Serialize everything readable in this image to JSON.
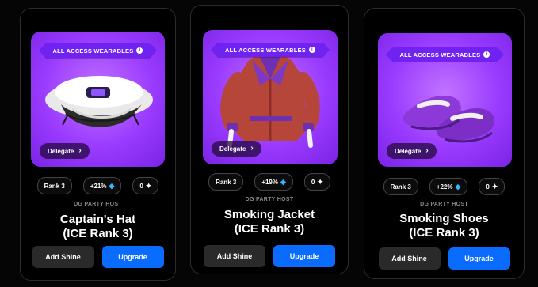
{
  "cards": [
    {
      "badge": "ALL ACCESS WEARABLES",
      "delegate": "Delegate",
      "rank": "Rank 3",
      "bonus": "+21%",
      "count": "0",
      "host": "DG PARTY HOST",
      "title_line1": "Captain's Hat",
      "title_line2": "(ICE Rank 3)",
      "add_shine": "Add Shine",
      "upgrade": "Upgrade"
    },
    {
      "badge": "ALL ACCESS WEARABLES",
      "delegate": "Delegate",
      "rank": "Rank 3",
      "bonus": "+19%",
      "count": "0",
      "host": "DG PARTY HOST",
      "title_line1": "Smoking Jacket",
      "title_line2": "(ICE Rank 3)",
      "add_shine": "Add Shine",
      "upgrade": "Upgrade"
    },
    {
      "badge": "ALL ACCESS WEARABLES",
      "delegate": "Delegate",
      "rank": "Rank 3",
      "bonus": "+22%",
      "count": "0",
      "host": "DG PARTY HOST",
      "title_line1": "Smoking Shoes",
      "title_line2": "(ICE Rank 3)",
      "add_shine": "Add Shine",
      "upgrade": "Upgrade"
    }
  ],
  "icons": {
    "info": "info-icon",
    "delegate_arrow": "chevron-right-icon",
    "bonus": "diamond-icon",
    "count": "sparkle-icon"
  },
  "colors": {
    "background": "#050505",
    "media_purple": "#9a3bff",
    "ribbon": "#6f22f0",
    "upgrade": "#0a6bff",
    "shine": "#2a2a2a"
  }
}
